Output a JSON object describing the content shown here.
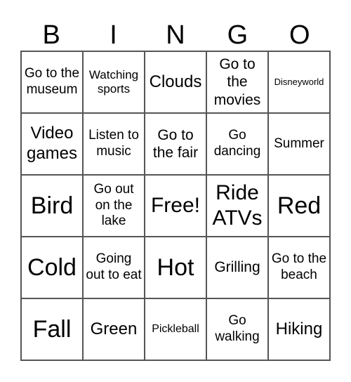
{
  "header": {
    "letters": [
      "B",
      "I",
      "N",
      "G",
      "O"
    ]
  },
  "cells": [
    "Go to the museum",
    "Watching sports",
    "Clouds",
    "Go to the movies",
    "Disneyworld",
    "Video games",
    "Listen to music",
    "Go to the fair",
    "Go dancing",
    "Summer",
    "Bird",
    "Go out on the lake",
    "Free!",
    "Ride ATVs",
    "Red",
    "Cold",
    "Going out to eat",
    "Hot",
    "Grilling",
    "Go to the beach",
    "Fall",
    "Green",
    "Pickleball",
    "Go walking",
    "Hiking"
  ]
}
